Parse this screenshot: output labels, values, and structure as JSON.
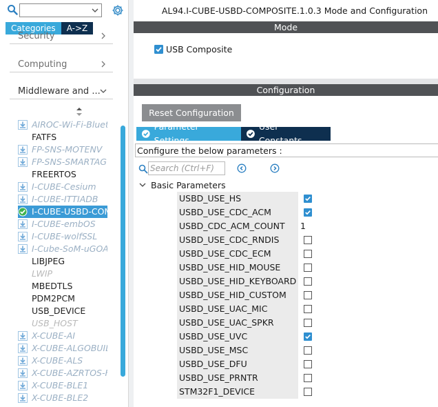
{
  "search": {
    "value": ""
  },
  "tabs": [
    {
      "label": "Categories"
    },
    {
      "label": "A->Z"
    }
  ],
  "categories": [
    {
      "label": "Security"
    },
    {
      "label": "Computing"
    },
    {
      "label": "Middleware and ..."
    }
  ],
  "middleware": [
    {
      "label": "AIROC-Wi-Fi-Bluet",
      "kind": "inst"
    },
    {
      "label": "FATFS",
      "kind": "plain"
    },
    {
      "label": "FP-SNS-MOTENV",
      "kind": "inst"
    },
    {
      "label": "FP-SNS-SMARTAG",
      "kind": "inst"
    },
    {
      "label": "FREERTOS",
      "kind": "plain"
    },
    {
      "label": "I-CUBE-Cesium",
      "kind": "inst"
    },
    {
      "label": "I-CUBE-ITTIADB",
      "kind": "inst"
    },
    {
      "label": "I-CUBE-USBD-COMPOSITE",
      "kind": "sel"
    },
    {
      "label": "I-CUBE-embOS",
      "kind": "inst"
    },
    {
      "label": "I-CUBE-wolfSSL",
      "kind": "inst"
    },
    {
      "label": "I-Cube-SoM-uGOAL",
      "kind": "inst"
    },
    {
      "label": "LIBJPEG",
      "kind": "plain"
    },
    {
      "label": "LWIP",
      "kind": "grey"
    },
    {
      "label": "MBEDTLS",
      "kind": "plain"
    },
    {
      "label": "PDM2PCM",
      "kind": "plain"
    },
    {
      "label": "USB_DEVICE",
      "kind": "plain"
    },
    {
      "label": "USB_HOST",
      "kind": "grey"
    },
    {
      "label": "X-CUBE-AI",
      "kind": "inst"
    },
    {
      "label": "X-CUBE-ALGOBUILD",
      "kind": "inst"
    },
    {
      "label": "X-CUBE-ALS",
      "kind": "inst"
    },
    {
      "label": "X-CUBE-AZRTOS-F1",
      "kind": "inst"
    },
    {
      "label": "X-CUBE-BLE1",
      "kind": "inst"
    },
    {
      "label": "X-CUBE-BLE2",
      "kind": "inst"
    }
  ],
  "main": {
    "title": "AL94.I-CUBE-USBD-COMPOSITE.1.0.3 Mode and Configuration",
    "mode_header": "Mode",
    "usb_composite": {
      "label": "USB Composite",
      "checked": true
    },
    "config_header": "Configuration",
    "reset_label": "Reset Configuration",
    "param_tabs": [
      {
        "label": "Parameter Settings"
      },
      {
        "label": "User Constants"
      }
    ],
    "configure_text": "Configure the below parameters :",
    "search_placeholder": "Search (Ctrl+F)",
    "group_label": "Basic Parameters",
    "params": [
      {
        "name": "USBD_USE_HS",
        "checked": true
      },
      {
        "name": "USBD_USE_CDC_ACM",
        "checked": true
      },
      {
        "name": "USBD_CDC_ACM_COUNT",
        "value": "1"
      },
      {
        "name": "USBD_USE_CDC_RNDIS",
        "checked": false
      },
      {
        "name": "USBD_USE_CDC_ECM",
        "checked": false
      },
      {
        "name": "USBD_USE_HID_MOUSE",
        "checked": false
      },
      {
        "name": "USBD_USE_HID_KEYBOARD",
        "checked": false
      },
      {
        "name": "USBD_USE_HID_CUSTOM",
        "checked": false
      },
      {
        "name": "USBD_USE_UAC_MIC",
        "checked": false
      },
      {
        "name": "USBD_USE_UAC_SPKR",
        "checked": false
      },
      {
        "name": "USBD_USE_UVC",
        "checked": true
      },
      {
        "name": "USBD_USE_MSC",
        "checked": false
      },
      {
        "name": "USBD_USE_DFU",
        "checked": false
      },
      {
        "name": "USBD_USE_PRNTR",
        "checked": false
      },
      {
        "name": "STM32F1_DEVICE",
        "checked": false
      }
    ]
  },
  "colors": {
    "accent": "#39a9db",
    "dark_tab": "#0e2f4f",
    "header_bar": "#505255",
    "selected": "#3b9bd6"
  }
}
